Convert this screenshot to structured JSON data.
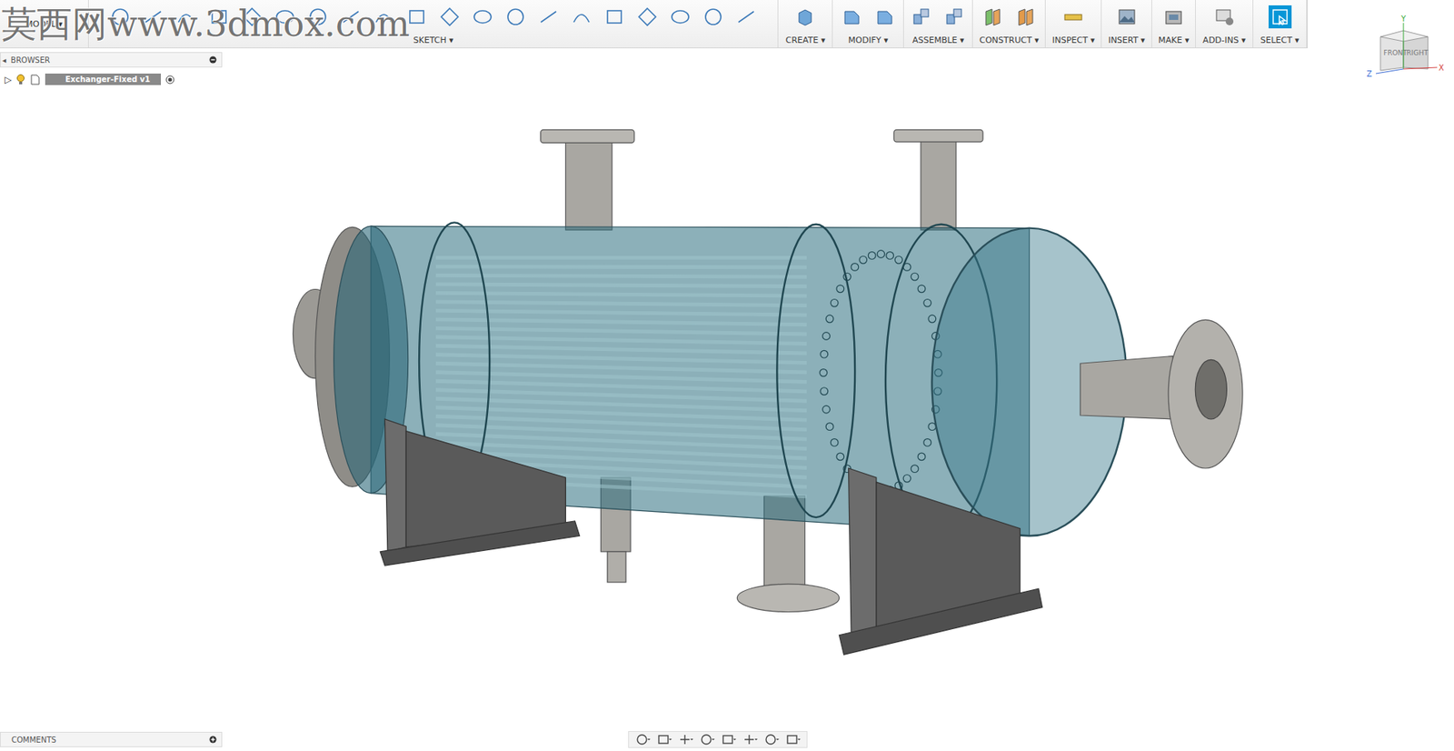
{
  "watermark": "莫西网www.3dmox.com",
  "menu_arrow": "▾",
  "toolbar": {
    "workspace": {
      "label": "MODEL"
    },
    "groups": [
      {
        "label": "SKETCH",
        "selected": false
      },
      {
        "label": "CREATE",
        "selected": false
      },
      {
        "label": "MODIFY",
        "selected": false
      },
      {
        "label": "ASSEMBLE",
        "selected": false
      },
      {
        "label": "CONSTRUCT",
        "selected": false
      },
      {
        "label": "INSPECT",
        "selected": false
      },
      {
        "label": "INSERT",
        "selected": false
      },
      {
        "label": "MAKE",
        "selected": false
      },
      {
        "label": "ADD-INS",
        "selected": false
      },
      {
        "label": "SELECT",
        "selected": true
      }
    ]
  },
  "browser": {
    "title": "BROWSER",
    "collapse": "◂",
    "items": [
      {
        "label": "Exchanger-Fixed v1",
        "expander": "▷",
        "expanded": false,
        "visible": true
      }
    ]
  },
  "comments": {
    "title": "COMMENTS"
  },
  "view_cube": {
    "front": "FRONT",
    "right": "RIGHT",
    "x": "X",
    "y": "Y",
    "z": "Z"
  }
}
